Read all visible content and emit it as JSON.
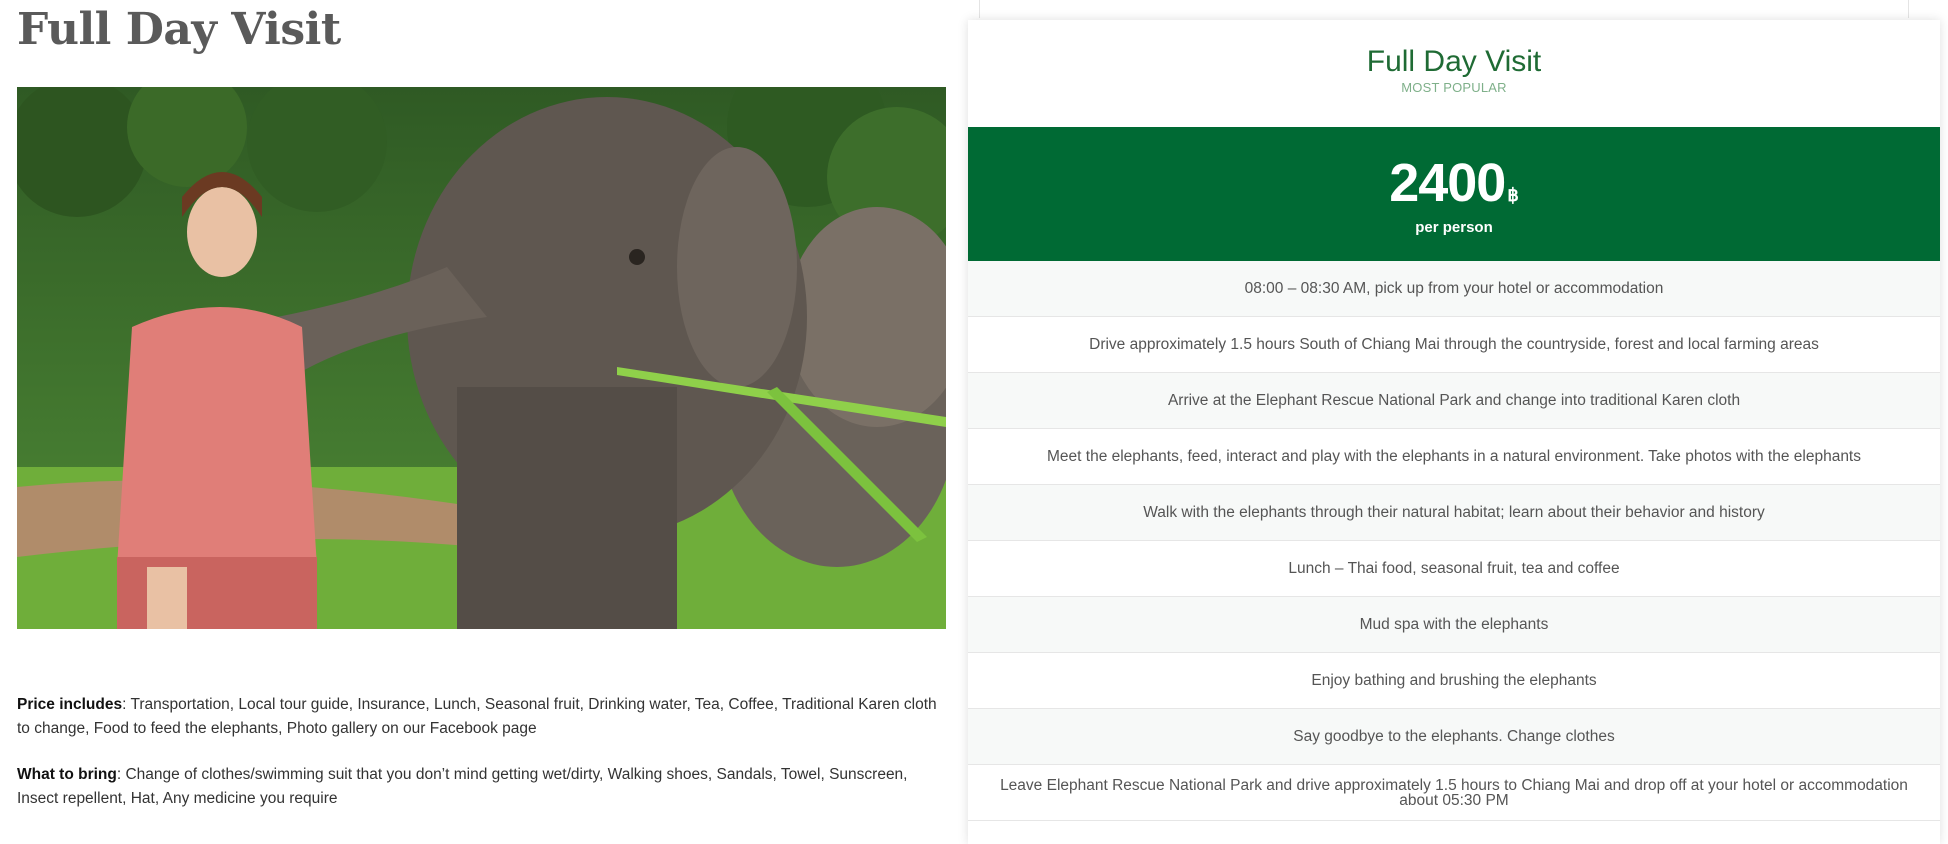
{
  "page": {
    "title": "Full Day Visit"
  },
  "includes": {
    "label": "Price includes",
    "text": ": Transportation, Local tour guide, Insurance, Lunch, Seasonal fruit, Drinking water, Tea, Coffee, Traditional Karen cloth to change, Food to feed the elephants, Photo gallery on our Facebook page"
  },
  "bring": {
    "label": "What to bring",
    "text": ": Change of clothes/swimming suit that you don’t mind getting wet/dirty, Walking shoes, Sandals, Towel, Sunscreen, Insect repellent, Hat, Any medicine you require"
  },
  "plan": {
    "name": "Full Day Visit",
    "badge": "MOST POPULAR",
    "price": "2400",
    "currency": "฿",
    "unit": "per person",
    "features": [
      "08:00 – 08:30 AM, pick up from your hotel or accommodation",
      "Drive approximately 1.5 hours South of Chiang Mai through the countryside, forest and local farming areas",
      "Arrive at the Elephant Rescue National Park and change into traditional Karen cloth",
      "Meet the elephants, feed, interact and play with the elephants in a natural environment. Take photos with the elephants",
      "Walk with the elephants through their natural habitat; learn about their behavior and history",
      "Lunch – Thai food, seasonal fruit, tea and coffee",
      "Mud spa with the elephants",
      "Enjoy bathing and brushing the elephants",
      "Say goodbye to the elephants. Change clothes",
      "Leave Elephant Rescue National Park and drive approximately 1.5 hours to Chiang Mai and drop off at your hotel or accommodation about 05:30 PM"
    ]
  },
  "colors": {
    "brand_green": "#006a34",
    "title_green": "#1f6b34",
    "badge_green": "#7fb08a"
  }
}
